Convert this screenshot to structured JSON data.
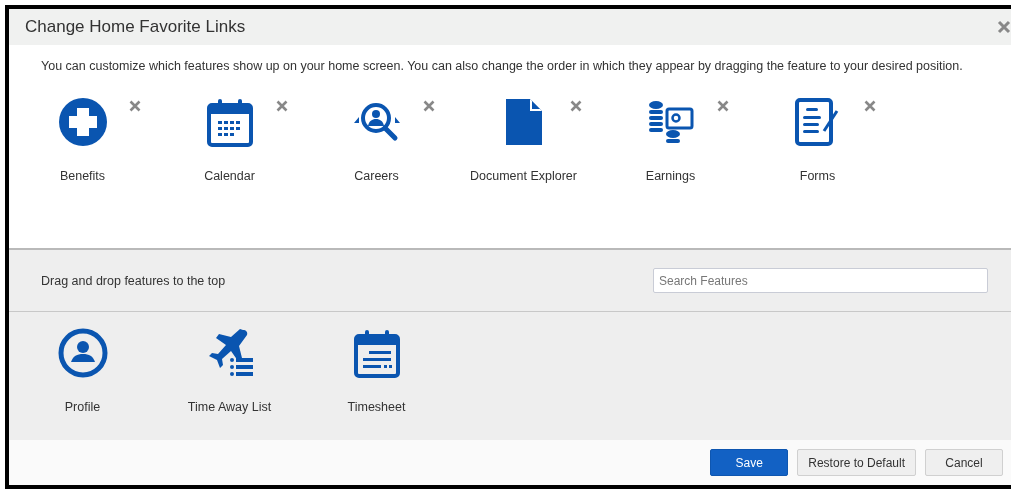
{
  "dialog": {
    "title": "Change Home Favorite Links",
    "intro": "You can customize which features show up on your home screen. You can also change the order in which they appear by dragging the feature to your desired position."
  },
  "favorites": [
    {
      "label": "Benefits"
    },
    {
      "label": "Calendar"
    },
    {
      "label": "Careers"
    },
    {
      "label": "Document Explorer"
    },
    {
      "label": "Earnings"
    },
    {
      "label": "Forms"
    }
  ],
  "available": {
    "hint": "Drag and drop features to the top",
    "search": {
      "placeholder": "Search Features"
    },
    "items": [
      {
        "label": "Profile"
      },
      {
        "label": "Time Away List"
      },
      {
        "label": "Timesheet"
      }
    ]
  },
  "buttons": [
    {
      "label": "Save",
      "kind": "primary"
    },
    {
      "label": "Restore to Default",
      "kind": "secondary"
    },
    {
      "label": "Cancel",
      "kind": "secondary"
    }
  ]
}
